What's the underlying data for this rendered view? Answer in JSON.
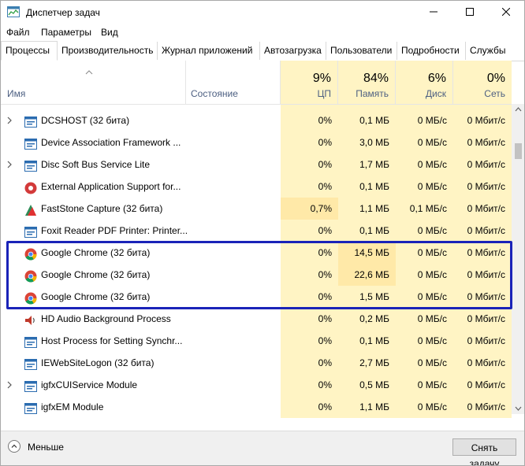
{
  "window": {
    "title": "Диспетчер задач"
  },
  "menu": [
    "Файл",
    "Параметры",
    "Вид"
  ],
  "tabs": [
    "Процессы",
    "Производительность",
    "Журнал приложений",
    "Автозагрузка",
    "Пользователи",
    "Подробности",
    "Службы"
  ],
  "active_tab": "Процессы",
  "columns": {
    "name": "Имя",
    "status": "Состояние",
    "cpu": {
      "pct": "9%",
      "label": "ЦП"
    },
    "memory": {
      "pct": "84%",
      "label": "Память"
    },
    "disk": {
      "pct": "6%",
      "label": "Диск"
    },
    "network": {
      "pct": "0%",
      "label": "Сеть"
    }
  },
  "processes": [
    {
      "name": "DCSHOST (32 бита)",
      "expandable": true,
      "icon": "app-window-icon",
      "cpu": "0%",
      "mem": "0,1 МБ",
      "disk": "0 МБ/с",
      "net": "0 Мбит/с"
    },
    {
      "name": "Device Association Framework ...",
      "expandable": false,
      "icon": "app-window-icon",
      "cpu": "0%",
      "mem": "3,0 МБ",
      "disk": "0 МБ/с",
      "net": "0 Мбит/с"
    },
    {
      "name": "Disc Soft Bus Service Lite",
      "expandable": true,
      "icon": "app-window-icon",
      "cpu": "0%",
      "mem": "1,7 МБ",
      "disk": "0 МБ/с",
      "net": "0 Мбит/с"
    },
    {
      "name": "External Application Support for...",
      "expandable": false,
      "icon": "red-circle-app-icon",
      "cpu": "0%",
      "mem": "0,1 МБ",
      "disk": "0 МБ/с",
      "net": "0 Мбит/с"
    },
    {
      "name": "FastStone Capture (32 бита)",
      "expandable": false,
      "icon": "faststone-icon",
      "cpu": "0,7%",
      "mem": "1,1 МБ",
      "disk": "0,1 МБ/с",
      "net": "0 Мбит/с",
      "hot_cpu": true
    },
    {
      "name": "Foxit Reader PDF Printer: Printer...",
      "expandable": false,
      "icon": "app-window-icon",
      "cpu": "0%",
      "mem": "0,1 МБ",
      "disk": "0 МБ/с",
      "net": "0 Мбит/с"
    },
    {
      "name": "Google Chrome (32 бита)",
      "expandable": false,
      "icon": "chrome-icon",
      "cpu": "0%",
      "mem": "14,5 МБ",
      "disk": "0 МБ/с",
      "net": "0 Мбит/с",
      "hot_mem": true
    },
    {
      "name": "Google Chrome (32 бита)",
      "expandable": false,
      "icon": "chrome-icon",
      "cpu": "0%",
      "mem": "22,6 МБ",
      "disk": "0 МБ/с",
      "net": "0 Мбит/с",
      "hot_mem": true
    },
    {
      "name": "Google Chrome (32 бита)",
      "expandable": false,
      "icon": "chrome-icon",
      "cpu": "0%",
      "mem": "1,5 МБ",
      "disk": "0 МБ/с",
      "net": "0 Мбит/с"
    },
    {
      "name": "HD Audio Background Process",
      "expandable": false,
      "icon": "speaker-icon",
      "cpu": "0%",
      "mem": "0,2 МБ",
      "disk": "0 МБ/с",
      "net": "0 Мбит/с"
    },
    {
      "name": "Host Process for Setting Synchr...",
      "expandable": false,
      "icon": "app-window-icon",
      "cpu": "0%",
      "mem": "0,1 МБ",
      "disk": "0 МБ/с",
      "net": "0 Мбит/с"
    },
    {
      "name": "IEWebSiteLogon (32 бита)",
      "expandable": false,
      "icon": "app-window-icon",
      "cpu": "0%",
      "mem": "2,7 МБ",
      "disk": "0 МБ/с",
      "net": "0 Мбит/с"
    },
    {
      "name": "igfxCUIService Module",
      "expandable": true,
      "icon": "app-window-icon",
      "cpu": "0%",
      "mem": "0,5 МБ",
      "disk": "0 МБ/с",
      "net": "0 Мбит/с"
    },
    {
      "name": "igfxEM Module",
      "expandable": false,
      "icon": "app-window-icon",
      "cpu": "0%",
      "mem": "1,1 МБ",
      "disk": "0 МБ/с",
      "net": "0 Мбит/с"
    }
  ],
  "footer": {
    "less_label": "Меньше",
    "end_task_label": "Снять задачу"
  },
  "colors": {
    "usage_bg": "#fff4c4",
    "usage_hot": "#ffe9a8",
    "highlight_border": "#1a23b8",
    "header_label": "#4d6082"
  }
}
